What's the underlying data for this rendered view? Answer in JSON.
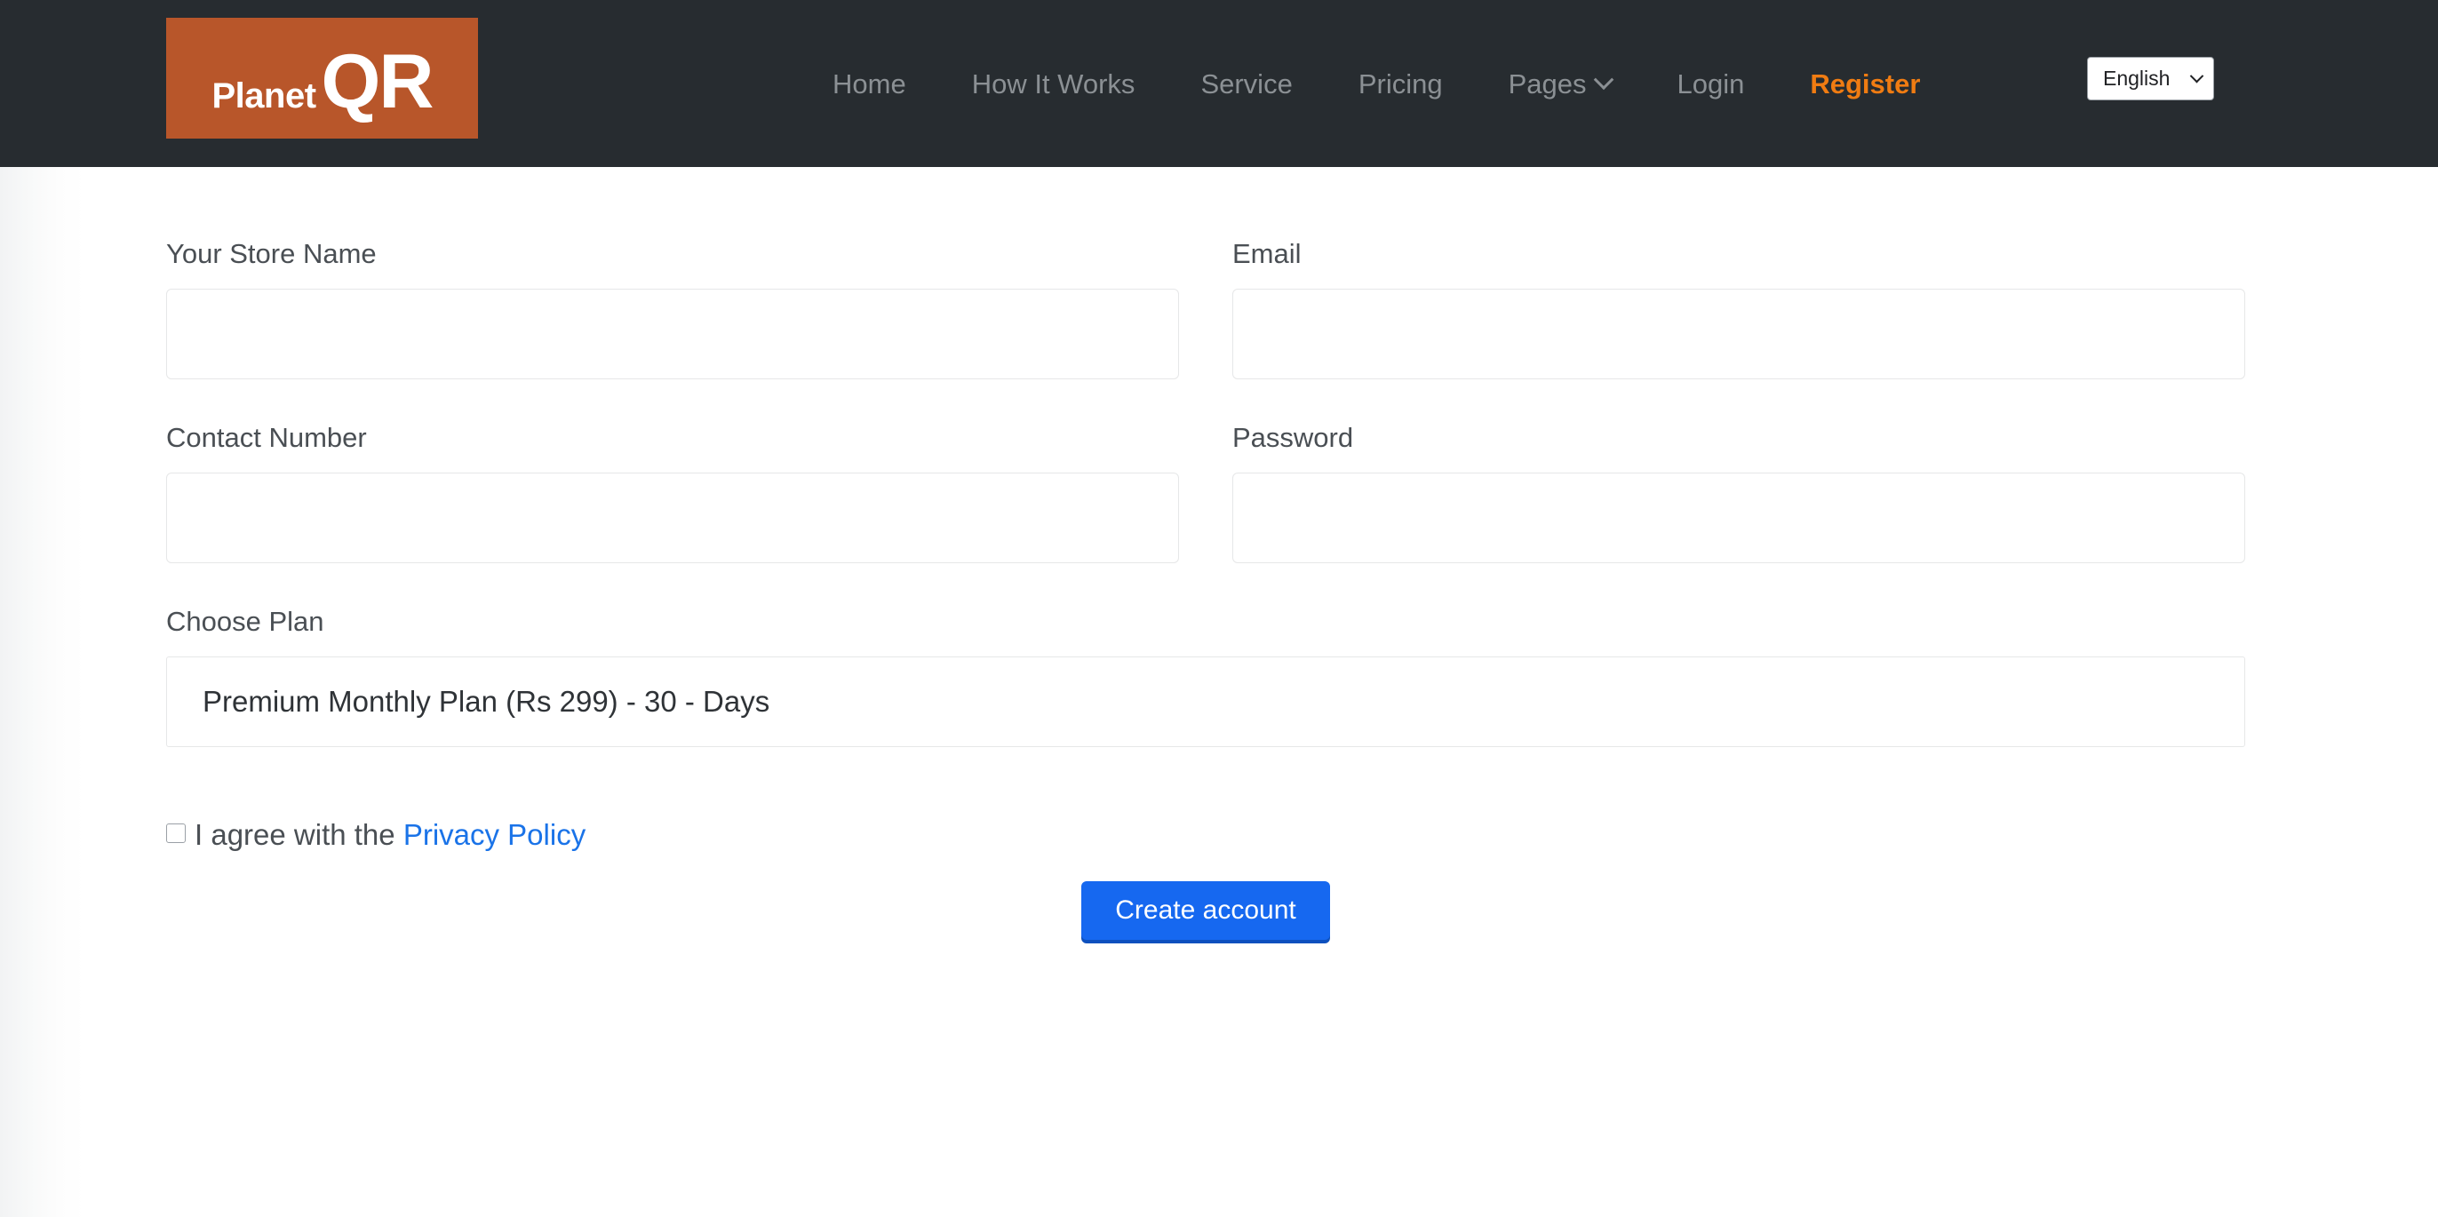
{
  "header": {
    "logo": {
      "part1": "Planet",
      "part2": "QR",
      "bg_color": "#b8562a"
    },
    "bg_color": "#272c30",
    "nav_items": [
      {
        "label": "Home",
        "has_chevron": false,
        "accent": false
      },
      {
        "label": "How It Works",
        "has_chevron": false,
        "accent": false
      },
      {
        "label": "Service",
        "has_chevron": false,
        "accent": false
      },
      {
        "label": "Pricing",
        "has_chevron": false,
        "accent": false
      },
      {
        "label": "Pages",
        "has_chevron": true,
        "accent": false
      },
      {
        "label": "Login",
        "has_chevron": false,
        "accent": false
      },
      {
        "label": "Register",
        "has_chevron": false,
        "accent": true
      }
    ],
    "language_select": {
      "value": "English",
      "icon": "chevron-down-icon"
    },
    "accent_color": "#f07c12",
    "nav_text_color": "#8b9094"
  },
  "form": {
    "fields": {
      "store_name": {
        "label": "Your Store Name",
        "value": "",
        "placeholder": ""
      },
      "email": {
        "label": "Email",
        "value": "",
        "placeholder": ""
      },
      "contact_number": {
        "label": "Contact Number",
        "value": "",
        "placeholder": ""
      },
      "password": {
        "label": "Password",
        "value": "",
        "placeholder": ""
      },
      "choose_plan": {
        "label": "Choose Plan",
        "selected": "Premium Monthly Plan (Rs 299) - 30 - Days"
      }
    },
    "agreement": {
      "checked": false,
      "text_before": "I agree with the ",
      "link_label": "Privacy Policy",
      "link_color": "#1a73e8"
    },
    "submit": {
      "label": "Create account",
      "bg_color": "#1668f0",
      "shadow_color": "#0d50be"
    }
  }
}
